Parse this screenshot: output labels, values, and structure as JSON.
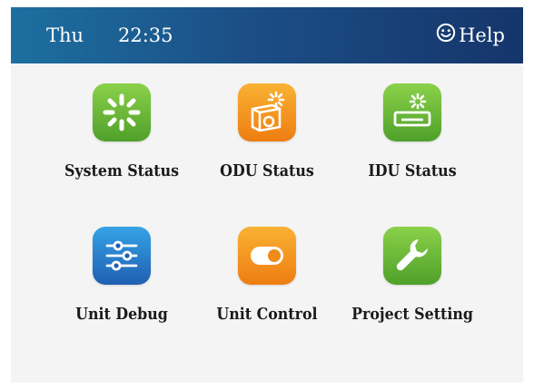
{
  "header": {
    "day": "Thu",
    "time": "22:35",
    "help_label": "Help"
  },
  "tiles": [
    {
      "label": "System Status",
      "icon": "system-status-icon",
      "color": "#5cb531"
    },
    {
      "label": "ODU Status",
      "icon": "odu-status-icon",
      "color": "#f29422"
    },
    {
      "label": "IDU Status",
      "icon": "idu-status-icon",
      "color": "#5cb531"
    },
    {
      "label": "Unit Debug",
      "icon": "sliders-icon",
      "color": "#2b7fd0"
    },
    {
      "label": "Unit Control",
      "icon": "toggle-icon",
      "color": "#f29422"
    },
    {
      "label": "Project Setting",
      "icon": "wrench-icon",
      "color": "#5cb531"
    }
  ]
}
